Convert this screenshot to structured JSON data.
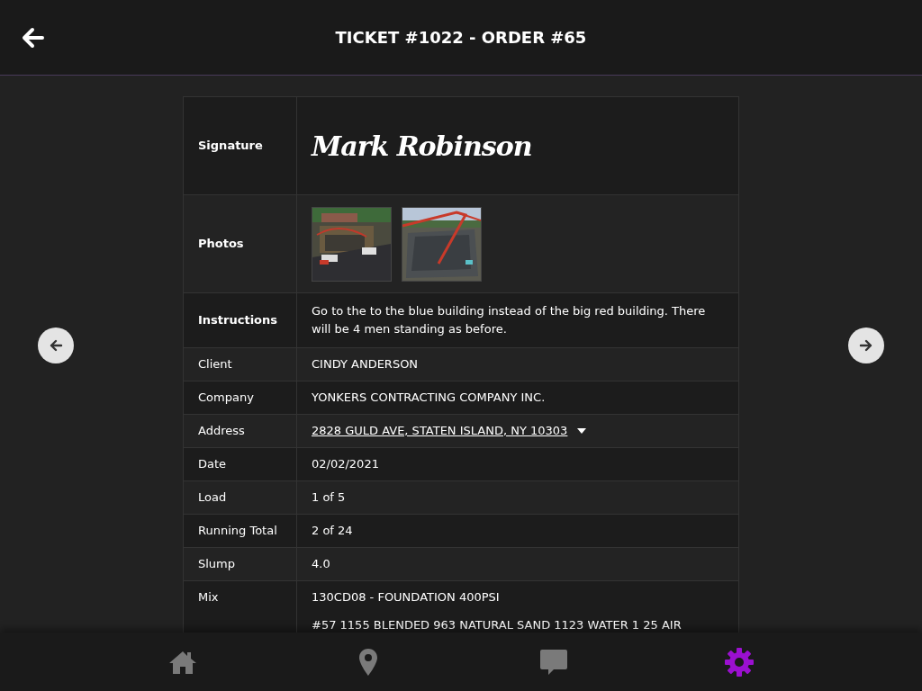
{
  "header": {
    "title": "TICKET #1022 - ORDER #65"
  },
  "rows": [
    {
      "kind": "signature",
      "label": "Signature",
      "value": "Mark Robinson"
    },
    {
      "kind": "photos",
      "label": "Photos"
    },
    {
      "kind": "text",
      "label": "Instructions",
      "value": "Go to the to the blue building instead of the big red building. There will be 4 men standing as before."
    },
    {
      "kind": "text",
      "label": "Client",
      "value": "CINDY ANDERSON"
    },
    {
      "kind": "text",
      "label": "Company",
      "value": "YONKERS CONTRACTING COMPANY INC."
    },
    {
      "kind": "address",
      "label": "Address",
      "value": "2828 GULD AVE, STATEN ISLAND, NY 10303"
    },
    {
      "kind": "text",
      "label": "Date",
      "value": "02/02/2021"
    },
    {
      "kind": "text",
      "label": "Load",
      "value": "1 of 5"
    },
    {
      "kind": "text",
      "label": "Running Total",
      "value": "2 of 24"
    },
    {
      "kind": "text",
      "label": "Slump",
      "value": "4.0"
    },
    {
      "kind": "mix",
      "label": "Mix",
      "lines": [
        "130CD08 - FOUNDATION 400PSI",
        "#57 1155 BLENDED 963 NATURAL SAND 1123 WATER 1 25 AIR"
      ]
    }
  ],
  "nav": [
    {
      "kind": "home",
      "selected": false
    },
    {
      "kind": "location",
      "selected": false
    },
    {
      "kind": "chat",
      "selected": false
    },
    {
      "kind": "settings",
      "selected": true
    }
  ]
}
